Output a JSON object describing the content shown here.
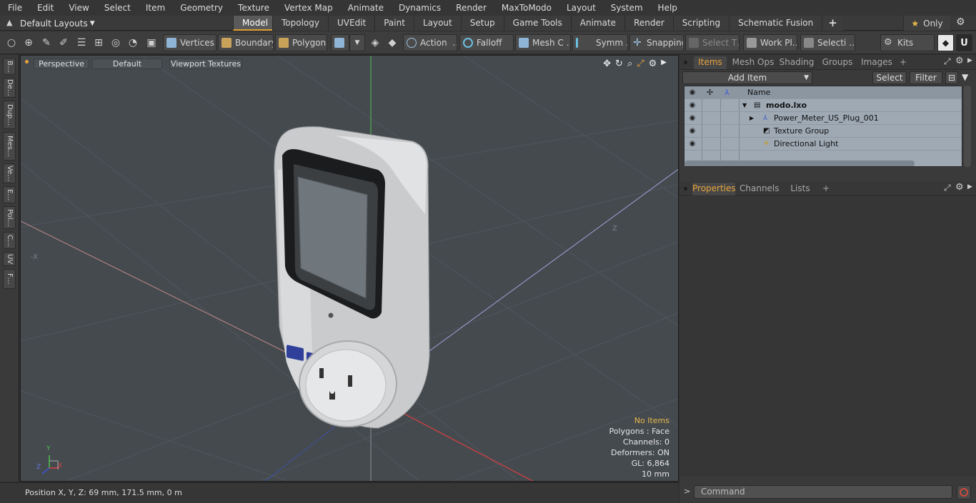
{
  "menu": [
    "File",
    "Edit",
    "View",
    "Select",
    "Item",
    "Geometry",
    "Texture",
    "Vertex Map",
    "Animate",
    "Dynamics",
    "Render",
    "MaxToModo",
    "Layout",
    "System",
    "Help"
  ],
  "layouts_label": "Default Layouts",
  "tabs": [
    "Model",
    "Topology",
    "UVEdit",
    "Paint",
    "Layout",
    "Setup",
    "Game Tools",
    "Animate",
    "Render",
    "Scripting",
    "Schematic Fusion"
  ],
  "active_tab": "Model",
  "only_label": "Only",
  "toolbar": {
    "vertices": "Vertices",
    "boundary": "Boundary",
    "polygons": "Polygons",
    "action": "Action",
    "falloff": "Falloff",
    "mesh": "Mesh C …",
    "symm": "Symm …",
    "snapping": "Snapping",
    "select_t": "Select T…",
    "work_plane": "Work Pl…",
    "selection": "Selecti …",
    "kits": "Kits"
  },
  "left_tabs": [
    "B…",
    "De…",
    "Dup…",
    "Mes…",
    "Ve…",
    "E…",
    "Pol…",
    "C…",
    "UV",
    "F…"
  ],
  "viewport": {
    "view": "Perspective",
    "shading": "Default",
    "textures": "Viewport Textures",
    "info": {
      "no_items": "No Items",
      "polygons": "Polygons : Face",
      "channels": "Channels: 0",
      "deformers": "Deformers: ON",
      "gl": "GL: 6,864",
      "scale": "10 mm"
    },
    "axis_x": "X",
    "axis_y": "Y",
    "axis_z": "Z"
  },
  "status": "Position X, Y, Z:   69 mm, 171.5 mm, 0 m",
  "items_panel": {
    "tabs": [
      "Items",
      "Mesh Ops",
      "Shading",
      "Groups",
      "Images"
    ],
    "add_item": "Add Item",
    "select": "Select",
    "filter": "Filter",
    "name_col": "Name",
    "tree": [
      {
        "name": "modo.lxo",
        "level": 0,
        "bold": true
      },
      {
        "name": "Power_Meter_US_Plug_001",
        "level": 1
      },
      {
        "name": "Texture Group",
        "level": 1
      },
      {
        "name": "Directional Light",
        "level": 1
      }
    ]
  },
  "props_panel": {
    "tabs": [
      "Properties",
      "Channels",
      "Lists"
    ]
  },
  "command_placeholder": "Command",
  "colors": {
    "accent": "#e8a43c",
    "viewport_bg": "#454a4f",
    "tree_bg": "#9ea9b4"
  }
}
